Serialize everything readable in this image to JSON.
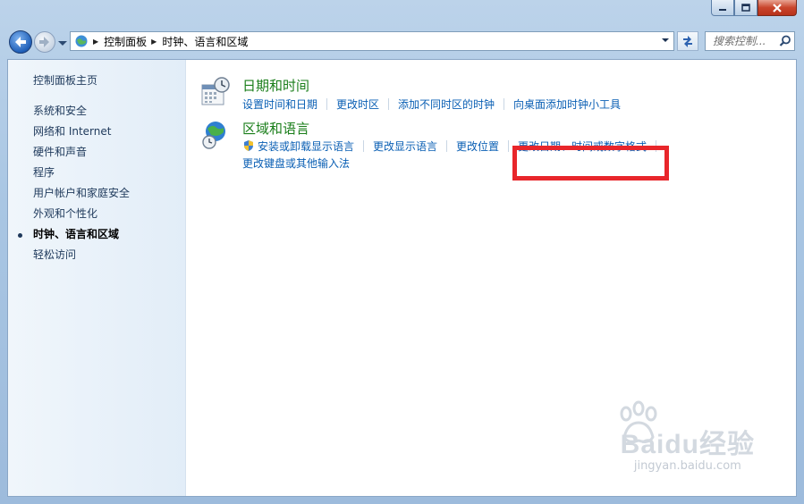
{
  "window": {
    "caption_buttons": [
      "minimize",
      "maximize",
      "close"
    ]
  },
  "nav": {
    "breadcrumb": [
      "控制面板",
      "时钟、语言和区域"
    ],
    "search_placeholder": "搜索控制..."
  },
  "sidebar": {
    "home": "控制面板主页",
    "items": [
      {
        "label": "系统和安全",
        "active": false
      },
      {
        "label": "网络和 Internet",
        "active": false
      },
      {
        "label": "硬件和声音",
        "active": false
      },
      {
        "label": "程序",
        "active": false
      },
      {
        "label": "用户帐户和家庭安全",
        "active": false
      },
      {
        "label": "外观和个性化",
        "active": false
      },
      {
        "label": "时钟、语言和区域",
        "active": true
      },
      {
        "label": "轻松访问",
        "active": false
      }
    ]
  },
  "categories": [
    {
      "title": "日期和时间",
      "icon": "calendar-clock-icon",
      "links": [
        "设置时间和日期",
        "更改时区",
        "添加不同时区的时钟",
        "向桌面添加时钟小工具"
      ]
    },
    {
      "title": "区域和语言",
      "icon": "globe-clock-icon",
      "links_row1": [
        "安装或卸载显示语言",
        "更改显示语言",
        "更改位置",
        "更改日期、时间或数字格式"
      ],
      "links_row2": [
        "更改键盘或其他输入法"
      ]
    }
  ],
  "highlight": {
    "target": "向桌面添加时钟小工具",
    "color": "#e8262b"
  },
  "watermark": {
    "brand": "Baidu经验",
    "url": "jingyan.baidu.com"
  }
}
